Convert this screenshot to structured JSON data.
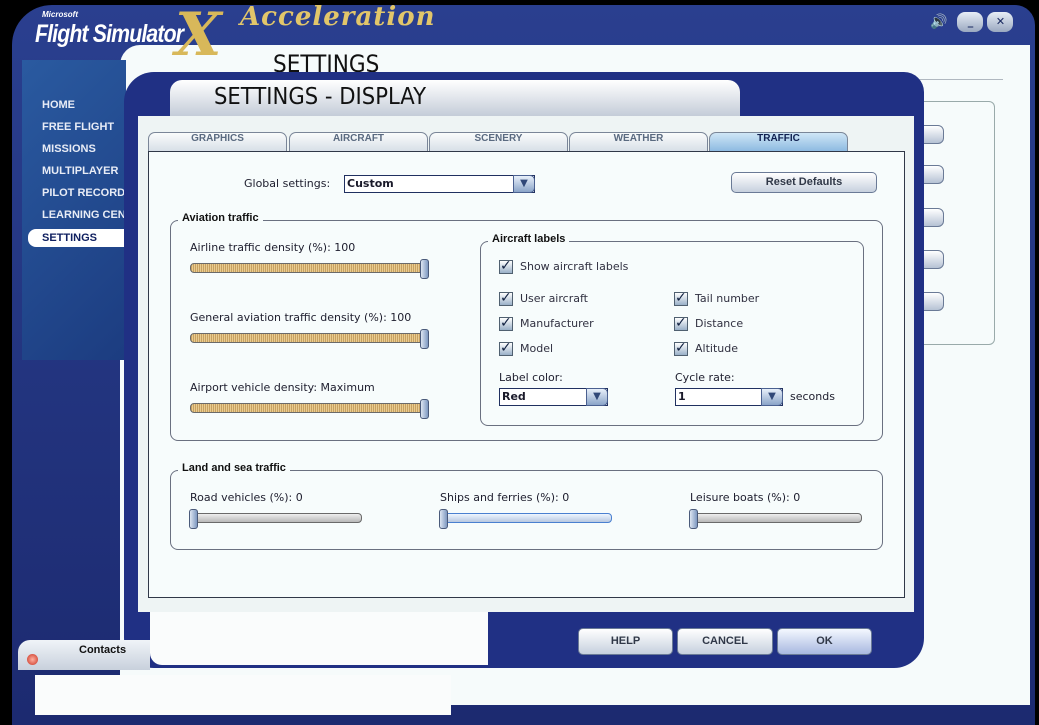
{
  "app": {
    "brand_small": "Microsoft",
    "brand": "Flight Simulator",
    "brand_x": "X",
    "edition": "Acceleration",
    "page_title": "SETTINGS"
  },
  "nav": [
    {
      "label": "HOME"
    },
    {
      "label": "FREE FLIGHT"
    },
    {
      "label": "MISSIONS"
    },
    {
      "label": "MULTIPLAYER"
    },
    {
      "label": "PILOT RECORDS"
    },
    {
      "label": "LEARNING CENTER"
    },
    {
      "label": "SETTINGS",
      "active": true
    }
  ],
  "window": {
    "speaker_icon": "🔊",
    "minimize": "_",
    "close": "✕"
  },
  "dialog": {
    "title": "SETTINGS - DISPLAY",
    "tabs": [
      {
        "label": "GRAPHICS"
      },
      {
        "label": "AIRCRAFT"
      },
      {
        "label": "SCENERY"
      },
      {
        "label": "WEATHER"
      },
      {
        "label": "TRAFFIC",
        "active": true
      }
    ],
    "global_label": "Global settings:",
    "global_value": "Custom",
    "reset": "Reset Defaults",
    "aviation": {
      "title": "Aviation traffic",
      "airline": {
        "label": "Airline traffic density (%): 100",
        "value": 100
      },
      "general": {
        "label": "General aviation traffic density (%): 100",
        "value": 100
      },
      "vehicle": {
        "label": "Airport vehicle density: Maximum",
        "value": 100
      }
    },
    "labels": {
      "title": "Aircraft labels",
      "show": "Show aircraft labels",
      "user": "User aircraft",
      "tail": "Tail number",
      "manufacturer": "Manufacturer",
      "distance": "Distance",
      "model": "Model",
      "altitude": "Altitude",
      "check": "✓",
      "color_label": "Label color:",
      "color_value": "Red",
      "cycle_label": "Cycle rate:",
      "cycle_value": "1",
      "seconds": "seconds"
    },
    "land": {
      "title": "Land and sea traffic",
      "road": {
        "label": "Road vehicles (%): 0",
        "value": 0
      },
      "ships": {
        "label": "Ships and ferries (%): 0",
        "value": 0
      },
      "leisure": {
        "label": "Leisure boats (%): 0",
        "value": 0
      }
    },
    "help": "HELP",
    "cancel": "CANCEL",
    "ok": "OK"
  },
  "contacts": "Contacts"
}
